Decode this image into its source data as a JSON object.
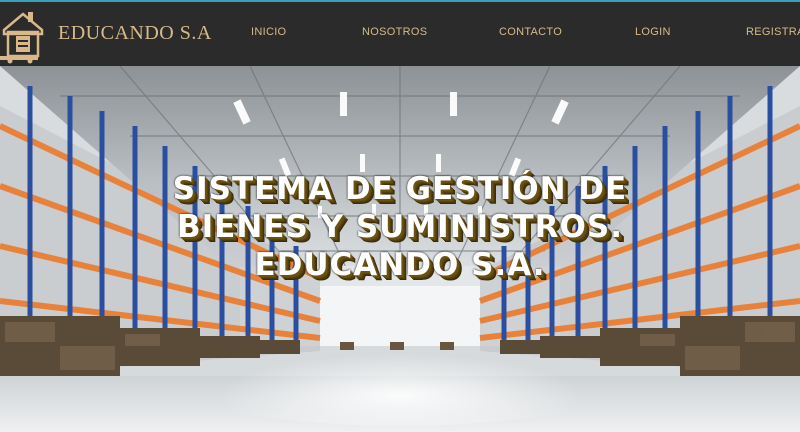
{
  "brand": {
    "name": "EDUCANDO S.A",
    "logo_icon": "warehouse-logo-icon"
  },
  "nav": {
    "inicio": "INICIO",
    "nosotros": "NOSOTROS",
    "contacto": "CONTACTO",
    "login": "LOGIN",
    "registrate": "REGISTRATE"
  },
  "hero": {
    "line1": "SISTEMA DE GESTIÓN DE",
    "line2": "BIENES Y SUMINISTROS.",
    "line3": "EDUCANDO S.A."
  },
  "colors": {
    "navbar": "#2b2b2b",
    "accent_gold": "#d9b98a",
    "rack_orange": "#e8823a",
    "rack_blue": "#2a4fa0"
  }
}
